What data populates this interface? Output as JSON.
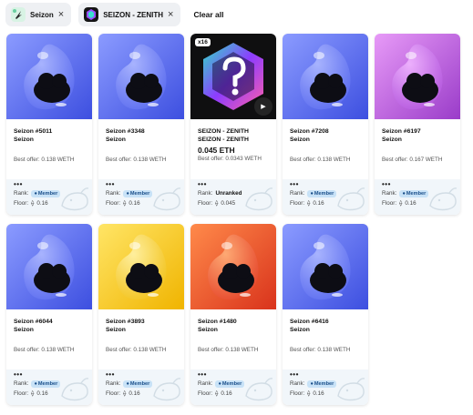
{
  "filters": {
    "chip1_label": "Seizon",
    "chip2_label": "SEIZON - ZENITH",
    "remove_glyph": "×",
    "clear_all": "Clear all"
  },
  "labels": {
    "rank": "Rank:",
    "floor": "Floor:",
    "eth_glyph": "⟠",
    "lock_glyph": "🔒",
    "dots": "•••",
    "play_glyph": "▶"
  },
  "cards": [
    {
      "title": "Seizon #5011",
      "subtitle": "Seizon",
      "price": "",
      "offer": "Best offer: 0.138 WETH",
      "rank": "Member",
      "floor": "0.16",
      "art": "blue"
    },
    {
      "title": "Seizon #3348",
      "subtitle": "Seizon",
      "price": "",
      "offer": "Best offer: 0.138 WETH",
      "rank": "Member",
      "floor": "0.16",
      "art": "blue"
    },
    {
      "title": "SEIZON - ZENITH",
      "subtitle": "SEIZON - ZENITH",
      "price": "0.045 ETH",
      "offer": "Best offer: 0.0343 WETH",
      "rank": "Unranked",
      "floor": "0.045",
      "art": "zenith",
      "badge": "x16"
    },
    {
      "title": "Seizon #7208",
      "subtitle": "Seizon",
      "price": "",
      "offer": "Best offer: 0.138 WETH",
      "rank": "Member",
      "floor": "0.16",
      "art": "blue"
    },
    {
      "title": "Seizon #6197",
      "subtitle": "Seizon",
      "price": "",
      "offer": "Best offer: 0.167 WETH",
      "rank": "Member",
      "floor": "0.16",
      "art": "purple"
    },
    {
      "title": "Seizon #6044",
      "subtitle": "Seizon",
      "price": "",
      "offer": "Best offer: 0.138 WETH",
      "rank": "Member",
      "floor": "0.16",
      "art": "blue"
    },
    {
      "title": "Seizon #3893",
      "subtitle": "Seizon",
      "price": "",
      "offer": "Best offer: 0.138 WETH",
      "rank": "Member",
      "floor": "0.16",
      "art": "yellow"
    },
    {
      "title": "Seizon #1480",
      "subtitle": "Seizon",
      "price": "",
      "offer": "Best offer: 0.138 WETH",
      "rank": "Member",
      "floor": "0.16",
      "art": "red"
    },
    {
      "title": "Seizon #6416",
      "subtitle": "Seizon",
      "price": "",
      "offer": "Best offer: 0.138 WETH",
      "rank": "Member",
      "floor": "0.16",
      "art": "blue"
    }
  ],
  "colors": {
    "chip_bg": "#eef0f3",
    "member_badge_bg": "#c8e2f7",
    "footer_bg": "#f1f6fa",
    "art_blue": "#4f63e8",
    "art_purple": "#b85ad9",
    "art_yellow": "#f2c21b",
    "art_red": "#e6452b",
    "art_zenith_bg": "#0f0f10"
  }
}
